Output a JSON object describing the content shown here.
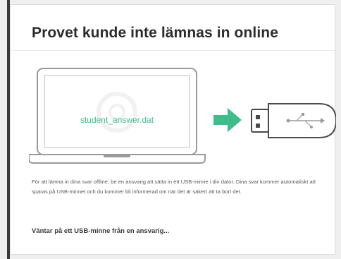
{
  "dialog": {
    "title": "Provet kunde inte lämnas in online",
    "illustration": {
      "laptop_screen_text": "student_answer.dat",
      "laptop_icon": "laptop-icon",
      "arrow_icon": "arrow-right-icon",
      "usb_icon": "usb-stick-icon",
      "accent_color": "#3ebd8a"
    },
    "body": "För att lämna in dina svar offline, be en ansvarig att sätta in ett USB-minne i din dator. Dina svar kommer automatiskt att sparas på USB-minnet och du kommer bli informerad om när det är säkert att ta bort det.",
    "status": "Väntar på ett USB-minne från en ansvarig..."
  }
}
